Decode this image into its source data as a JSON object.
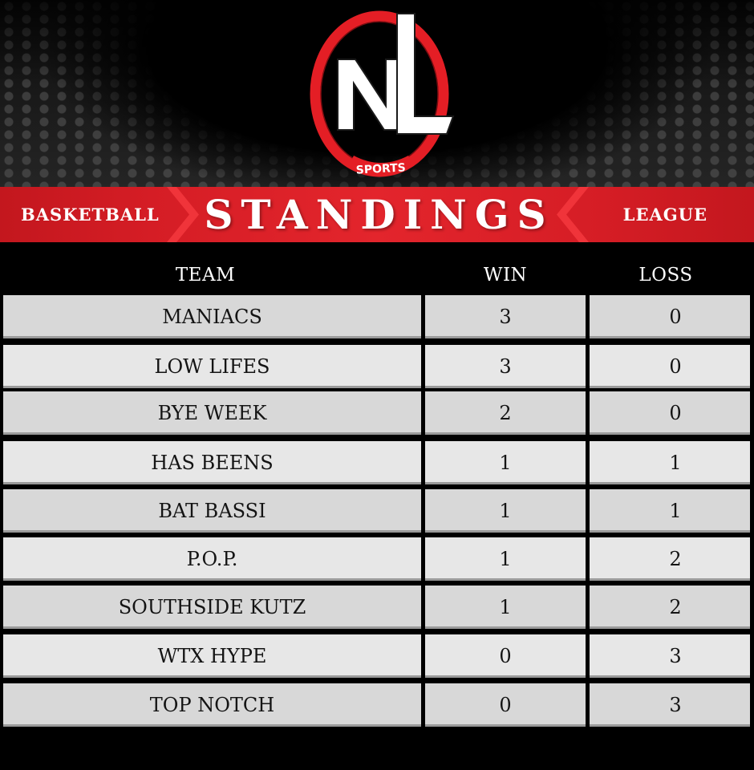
{
  "logo": {
    "letters": "NL",
    "subtext": "SPORTS",
    "colors": {
      "ring": "#e41e25",
      "letters": "#ffffff",
      "shadow": "#1a1a1a"
    }
  },
  "banner": {
    "left_label": "BASKETBALL",
    "title": "STANDINGS",
    "right_label": "LEAGUE",
    "color": "#d51d25"
  },
  "table": {
    "headers": {
      "team": "TEAM",
      "win": "WIN",
      "loss": "LOSS"
    },
    "rows": [
      {
        "team": "MANIACS",
        "win": "3",
        "loss": "0"
      },
      {
        "team": "LOW LIFES",
        "win": "3",
        "loss": "0"
      },
      {
        "team": "BYE WEEK",
        "win": "2",
        "loss": "0"
      },
      {
        "team": "HAS BEENS",
        "win": "1",
        "loss": "1"
      },
      {
        "team": "BAT BASSI",
        "win": "1",
        "loss": "1"
      },
      {
        "team": "P.O.P.",
        "win": "1",
        "loss": "2"
      },
      {
        "team": "SOUTHSIDE KUTZ",
        "win": "1",
        "loss": "2"
      },
      {
        "team": "WTX HYPE",
        "win": "0",
        "loss": "3"
      },
      {
        "team": "TOP NOTCH",
        "win": "0",
        "loss": "3"
      }
    ]
  }
}
